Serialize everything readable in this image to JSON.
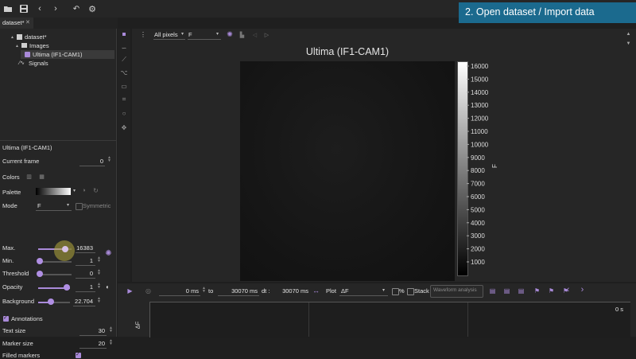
{
  "toolbar": {
    "icons": [
      "folder-open-icon",
      "save-icon",
      "back-icon",
      "forward-icon",
      "undo-icon",
      "settings-icon"
    ]
  },
  "banner": {
    "text": "2. Open dataset / Import data",
    "color": "#1b6a8e"
  },
  "tabs": [
    {
      "label": "dataset*",
      "close": "✕"
    }
  ],
  "tree": {
    "root": "dataset*",
    "images": "Images",
    "image_item": "Ultima (IF1-CAM1)",
    "signals": "Signals"
  },
  "properties": {
    "title": "Ultima (IF1-CAM1)",
    "current_frame": {
      "label": "Current frame",
      "value": "0"
    },
    "colors": {
      "label": "Colors"
    },
    "palette": {
      "label": "Palette"
    },
    "mode": {
      "label": "Mode",
      "value": "F",
      "symmetric": "Symmetric"
    },
    "max": {
      "label": "Max.",
      "value": "16383",
      "level": 0.9
    },
    "min": {
      "label": "Min.",
      "value": "1",
      "level": 0.0
    },
    "threshold": {
      "label": "Threshold",
      "value": "0",
      "level": 0.0
    },
    "opacity": {
      "label": "Opacity",
      "value": "1",
      "level": 1.0
    },
    "background": {
      "label": "Background",
      "value": "22.704",
      "level": 0.4
    },
    "annotations": {
      "label": "Annotations",
      "checked": true
    },
    "text_size": {
      "label": "Text size",
      "value": "30"
    },
    "marker_size": {
      "label": "Marker size",
      "value": "20"
    },
    "filled_markers": {
      "label": "Filled markers",
      "checked": true
    }
  },
  "viewer": {
    "selector1": "All pixels",
    "selector2": "F",
    "image_title": "Ultima (IF1-CAM1)",
    "colorbar_label": "F",
    "colorbar_ticks": [
      "16000",
      "15000",
      "14000",
      "13000",
      "12000",
      "11000",
      "10000",
      "9000",
      "8000",
      "7000",
      "6000",
      "5000",
      "4000",
      "3000",
      "2000",
      "1000"
    ]
  },
  "timeline": {
    "start": "0 ms",
    "to_label": "to",
    "end": "30070 ms",
    "dt_label": "dt :",
    "dt": "30070 ms",
    "plot_label": "Plot",
    "plot_value": "ΔF",
    "percent_label": "%",
    "stack_label": "Stack",
    "waveform_button": "Waveform analysis",
    "time_readout": "0 s",
    "yaxis_label": "ΔF"
  },
  "colors": {
    "accent": "#a98ad9",
    "banner": "#1b6a8e"
  }
}
